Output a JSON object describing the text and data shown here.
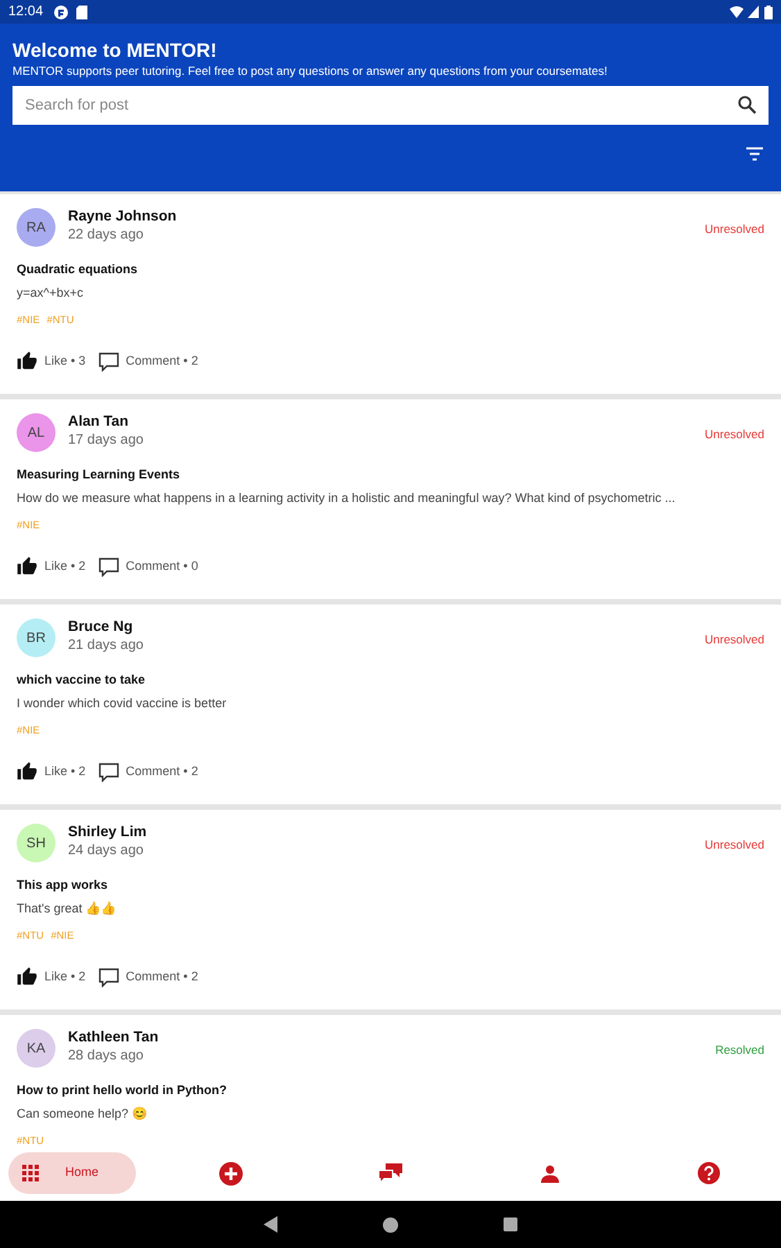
{
  "status_bar": {
    "time": "12:04"
  },
  "header": {
    "title": "Welcome to MENTOR!",
    "subtitle": "MENTOR supports peer tutoring. Feel free to post any questions or answer any questions from your coursemates!",
    "search": {
      "placeholder": "Search for post"
    }
  },
  "posts": [
    {
      "initials": "RA",
      "color": "#a9abf0",
      "author": "Rayne Johnson",
      "time": "22 days ago",
      "resolved": false,
      "status": "Unresolved",
      "title": "Quadratic equations",
      "body": "y=ax^+bx+c",
      "tags": [
        "#NIE",
        "#NTU"
      ],
      "likes": "Like • 3",
      "comments": "Comment • 2"
    },
    {
      "initials": "AL",
      "color": "#ea94ea",
      "author": "Alan Tan",
      "time": "17 days ago",
      "resolved": false,
      "status": "Unresolved",
      "title": "Measuring Learning Events",
      "body": "How do we measure what happens in a learning activity in a holistic and meaningful way? What kind of psychometric ...",
      "tags": [
        "#NIE"
      ],
      "likes": "Like • 2",
      "comments": "Comment • 0"
    },
    {
      "initials": "BR",
      "color": "#b4eef4",
      "author": "Bruce Ng",
      "time": "21 days ago",
      "resolved": false,
      "status": "Unresolved",
      "title": "which vaccine to take",
      "body": "I wonder which covid vaccine is better",
      "tags": [
        "#NIE"
      ],
      "likes": "Like • 2",
      "comments": "Comment • 2"
    },
    {
      "initials": "SH",
      "color": "#c9f7b4",
      "author": "Shirley Lim",
      "time": "24 days ago",
      "resolved": false,
      "status": "Unresolved",
      "title": "This app works",
      "body": "That's great 👍👍",
      "tags": [
        "#NTU",
        "#NIE"
      ],
      "likes": "Like • 2",
      "comments": "Comment • 2"
    },
    {
      "initials": "KA",
      "color": "#dccdea",
      "author": "Kathleen Tan",
      "time": "28 days ago",
      "resolved": true,
      "status": "Resolved",
      "title": "How to print hello world in Python?",
      "body": "Can someone help? 😊",
      "tags": [
        "#NTU"
      ]
    }
  ],
  "bottom_nav": [
    {
      "kind": "home",
      "label": "Home",
      "selected": true
    },
    {
      "kind": "add",
      "selected": false
    },
    {
      "kind": "chat",
      "selected": false
    },
    {
      "kind": "profile",
      "selected": false
    },
    {
      "kind": "help",
      "selected": false
    }
  ]
}
